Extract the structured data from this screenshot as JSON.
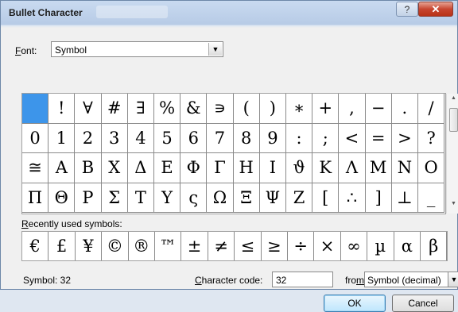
{
  "window": {
    "title": "Bullet Character"
  },
  "font": {
    "label_prefix": "",
    "label_accel": "F",
    "label_rest": "ont:",
    "value": "Symbol"
  },
  "grid": {
    "rows": [
      [
        " ",
        "!",
        "∀",
        "#",
        "∃",
        "%",
        "&",
        "∍",
        "(",
        ")",
        "∗",
        "+",
        ",",
        "−",
        ".",
        "/"
      ],
      [
        "0",
        "1",
        "2",
        "3",
        "4",
        "5",
        "6",
        "7",
        "8",
        "9",
        ":",
        ";",
        "<",
        "=",
        ">",
        "?"
      ],
      [
        "≅",
        "Α",
        "Β",
        "Χ",
        "Δ",
        "Ε",
        "Φ",
        "Γ",
        "Η",
        "Ι",
        "ϑ",
        "Κ",
        "Λ",
        "Μ",
        "Ν",
        "Ο"
      ],
      [
        "Π",
        "Θ",
        "Ρ",
        "Σ",
        "Τ",
        "Υ",
        "ς",
        "Ω",
        "Ξ",
        "Ψ",
        "Ζ",
        "[",
        "∴",
        "]",
        "⊥",
        "_"
      ]
    ]
  },
  "recent": {
    "label_accel": "R",
    "label_rest": "ecently used symbols:",
    "symbols": [
      "€",
      "£",
      "¥",
      "©",
      "®",
      "™",
      "±",
      "≠",
      "≤",
      "≥",
      "÷",
      "×",
      "∞",
      "µ",
      "α",
      "β"
    ]
  },
  "symbol_info": "Symbol: 32",
  "char_code": {
    "label_pre": "",
    "label_accel": "C",
    "label_rest": "haracter code:",
    "value": "32"
  },
  "from": {
    "label_pre": "fro",
    "label_accel": "m",
    "label_rest": ":",
    "value": "Symbol (decimal)"
  },
  "buttons": {
    "ok": "OK",
    "cancel": "Cancel",
    "help": "?",
    "close": "✕"
  }
}
